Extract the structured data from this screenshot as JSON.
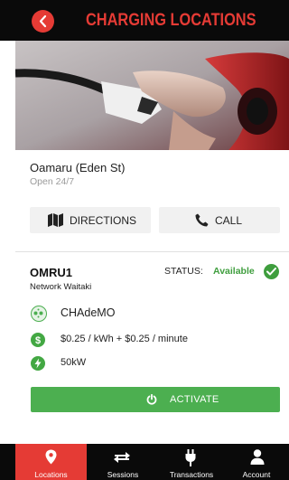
{
  "header": {
    "title": "CHARGING LOCATIONS"
  },
  "location": {
    "name": "Oamaru (Eden St)",
    "hours": "Open 24/7"
  },
  "actions": {
    "directions_label": "DIRECTIONS",
    "call_label": "CALL"
  },
  "station": {
    "code": "OMRU1",
    "network": "Network Waitaki",
    "status_label": "STATUS:",
    "status_value": "Available",
    "connector": "CHAdeMO",
    "price": "$0.25 / kWh + $0.25 / minute",
    "power": "50kW"
  },
  "activate_label": "ACTIVATE",
  "tabs": [
    {
      "label": "Locations",
      "icon": "map-pin-icon",
      "active": true
    },
    {
      "label": "Sessions",
      "icon": "swap-arrows-icon",
      "active": false
    },
    {
      "label": "Transactions",
      "icon": "plug-icon",
      "active": false
    },
    {
      "label": "Account",
      "icon": "user-icon",
      "active": false
    }
  ],
  "colors": {
    "accent": "#e53b35",
    "success": "#4caf50",
    "header": "#0a0a0a"
  }
}
